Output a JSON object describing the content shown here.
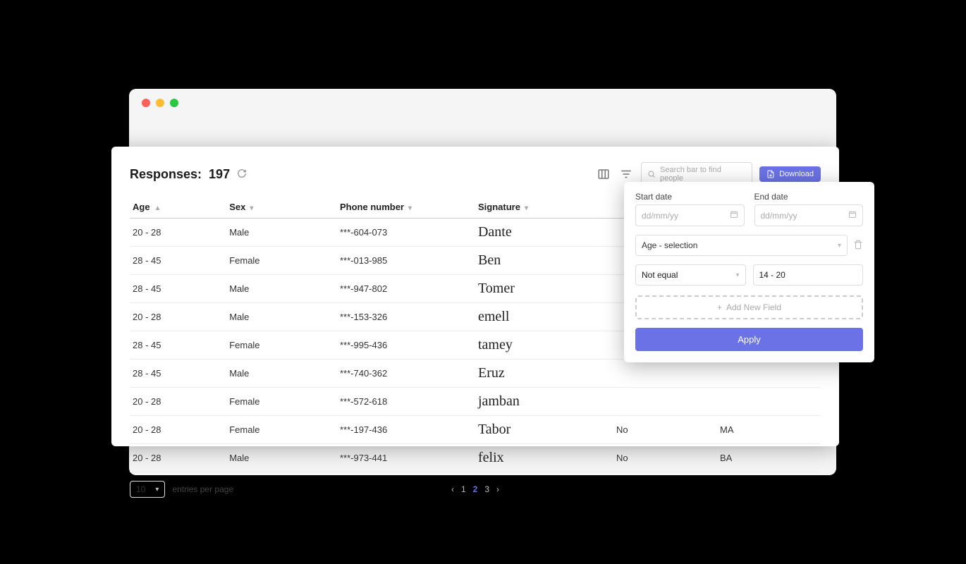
{
  "title_prefix": "Responses:",
  "title_count": "197",
  "search_placeholder": "Search bar to find people",
  "download_label": "Download",
  "columns": {
    "age": "Age",
    "sex": "Sex",
    "phone": "Phone number",
    "signature": "Signature",
    "col5": "",
    "col6": ""
  },
  "rows": [
    {
      "age": "20 - 28",
      "sex": "Male",
      "phone": "***-604-073",
      "sig": "Dante",
      "c5": "",
      "c6": ""
    },
    {
      "age": "28 - 45",
      "sex": "Female",
      "phone": "***-013-985",
      "sig": "Ben",
      "c5": "",
      "c6": ""
    },
    {
      "age": "28 - 45",
      "sex": "Male",
      "phone": "***-947-802",
      "sig": "Tomer",
      "c5": "",
      "c6": ""
    },
    {
      "age": "20 - 28",
      "sex": "Male",
      "phone": "***-153-326",
      "sig": "emell",
      "c5": "",
      "c6": ""
    },
    {
      "age": "28 - 45",
      "sex": "Female",
      "phone": "***-995-436",
      "sig": "tamey",
      "c5": "",
      "c6": ""
    },
    {
      "age": "28 - 45",
      "sex": "Male",
      "phone": "***-740-362",
      "sig": "Eruz",
      "c5": "",
      "c6": ""
    },
    {
      "age": "20 - 28",
      "sex": "Female",
      "phone": "***-572-618",
      "sig": "jamban",
      "c5": "",
      "c6": ""
    },
    {
      "age": "20 - 28",
      "sex": "Female",
      "phone": "***-197-436",
      "sig": "Tabor",
      "c5": "No",
      "c6": "MA"
    },
    {
      "age": "20 - 28",
      "sex": "Male",
      "phone": "***-973-441",
      "sig": "felix",
      "c5": "No",
      "c6": "BA"
    }
  ],
  "entries_value": "10",
  "entries_label": "entries per page",
  "pages": [
    "1",
    "2",
    "3"
  ],
  "active_page": "2",
  "filter": {
    "start_label": "Start date",
    "end_label": "End date",
    "date_placeholder": "dd/mm/yy",
    "field_select": "Age - selection",
    "condition": "Not equal",
    "value": "14 - 20",
    "add_label": "Add New Field",
    "apply_label": "Apply"
  }
}
